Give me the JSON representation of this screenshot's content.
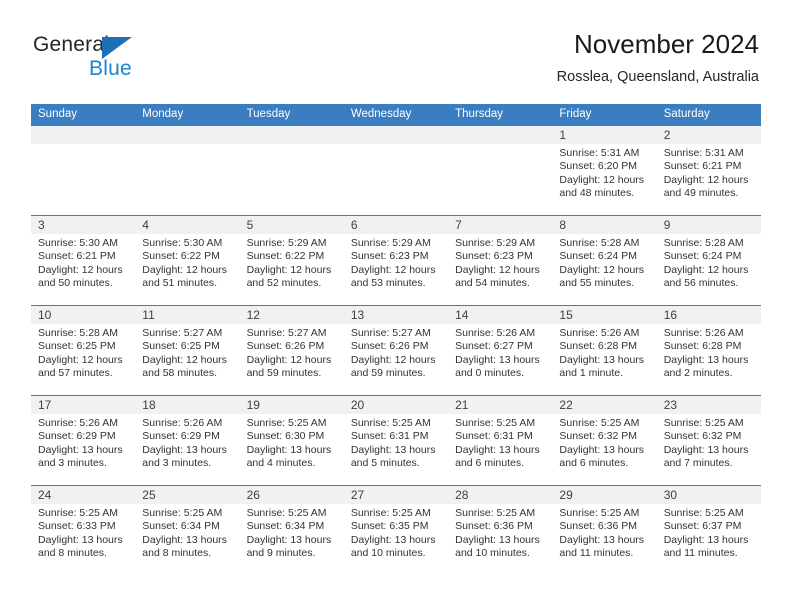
{
  "brand": {
    "name_top": "General",
    "name_bottom": "Blue"
  },
  "header": {
    "title": "November 2024",
    "subtitle": "Rosslea, Queensland, Australia"
  },
  "colors": {
    "header_blue": "#3a7dc0",
    "band_gray": "#f1f1f1",
    "logo_blue": "#1b84cf",
    "text": "#333333"
  },
  "weekdays": [
    "Sunday",
    "Monday",
    "Tuesday",
    "Wednesday",
    "Thursday",
    "Friday",
    "Saturday"
  ],
  "weeks": [
    [
      {
        "day": "",
        "sunrise": "",
        "sunset": "",
        "daylight1": "",
        "daylight2": ""
      },
      {
        "day": "",
        "sunrise": "",
        "sunset": "",
        "daylight1": "",
        "daylight2": ""
      },
      {
        "day": "",
        "sunrise": "",
        "sunset": "",
        "daylight1": "",
        "daylight2": ""
      },
      {
        "day": "",
        "sunrise": "",
        "sunset": "",
        "daylight1": "",
        "daylight2": ""
      },
      {
        "day": "",
        "sunrise": "",
        "sunset": "",
        "daylight1": "",
        "daylight2": ""
      },
      {
        "day": "1",
        "sunrise": "Sunrise: 5:31 AM",
        "sunset": "Sunset: 6:20 PM",
        "daylight1": "Daylight: 12 hours",
        "daylight2": "and 48 minutes."
      },
      {
        "day": "2",
        "sunrise": "Sunrise: 5:31 AM",
        "sunset": "Sunset: 6:21 PM",
        "daylight1": "Daylight: 12 hours",
        "daylight2": "and 49 minutes."
      }
    ],
    [
      {
        "day": "3",
        "sunrise": "Sunrise: 5:30 AM",
        "sunset": "Sunset: 6:21 PM",
        "daylight1": "Daylight: 12 hours",
        "daylight2": "and 50 minutes."
      },
      {
        "day": "4",
        "sunrise": "Sunrise: 5:30 AM",
        "sunset": "Sunset: 6:22 PM",
        "daylight1": "Daylight: 12 hours",
        "daylight2": "and 51 minutes."
      },
      {
        "day": "5",
        "sunrise": "Sunrise: 5:29 AM",
        "sunset": "Sunset: 6:22 PM",
        "daylight1": "Daylight: 12 hours",
        "daylight2": "and 52 minutes."
      },
      {
        "day": "6",
        "sunrise": "Sunrise: 5:29 AM",
        "sunset": "Sunset: 6:23 PM",
        "daylight1": "Daylight: 12 hours",
        "daylight2": "and 53 minutes."
      },
      {
        "day": "7",
        "sunrise": "Sunrise: 5:29 AM",
        "sunset": "Sunset: 6:23 PM",
        "daylight1": "Daylight: 12 hours",
        "daylight2": "and 54 minutes."
      },
      {
        "day": "8",
        "sunrise": "Sunrise: 5:28 AM",
        "sunset": "Sunset: 6:24 PM",
        "daylight1": "Daylight: 12 hours",
        "daylight2": "and 55 minutes."
      },
      {
        "day": "9",
        "sunrise": "Sunrise: 5:28 AM",
        "sunset": "Sunset: 6:24 PM",
        "daylight1": "Daylight: 12 hours",
        "daylight2": "and 56 minutes."
      }
    ],
    [
      {
        "day": "10",
        "sunrise": "Sunrise: 5:28 AM",
        "sunset": "Sunset: 6:25 PM",
        "daylight1": "Daylight: 12 hours",
        "daylight2": "and 57 minutes."
      },
      {
        "day": "11",
        "sunrise": "Sunrise: 5:27 AM",
        "sunset": "Sunset: 6:25 PM",
        "daylight1": "Daylight: 12 hours",
        "daylight2": "and 58 minutes."
      },
      {
        "day": "12",
        "sunrise": "Sunrise: 5:27 AM",
        "sunset": "Sunset: 6:26 PM",
        "daylight1": "Daylight: 12 hours",
        "daylight2": "and 59 minutes."
      },
      {
        "day": "13",
        "sunrise": "Sunrise: 5:27 AM",
        "sunset": "Sunset: 6:26 PM",
        "daylight1": "Daylight: 12 hours",
        "daylight2": "and 59 minutes."
      },
      {
        "day": "14",
        "sunrise": "Sunrise: 5:26 AM",
        "sunset": "Sunset: 6:27 PM",
        "daylight1": "Daylight: 13 hours",
        "daylight2": "and 0 minutes."
      },
      {
        "day": "15",
        "sunrise": "Sunrise: 5:26 AM",
        "sunset": "Sunset: 6:28 PM",
        "daylight1": "Daylight: 13 hours",
        "daylight2": "and 1 minute."
      },
      {
        "day": "16",
        "sunrise": "Sunrise: 5:26 AM",
        "sunset": "Sunset: 6:28 PM",
        "daylight1": "Daylight: 13 hours",
        "daylight2": "and 2 minutes."
      }
    ],
    [
      {
        "day": "17",
        "sunrise": "Sunrise: 5:26 AM",
        "sunset": "Sunset: 6:29 PM",
        "daylight1": "Daylight: 13 hours",
        "daylight2": "and 3 minutes."
      },
      {
        "day": "18",
        "sunrise": "Sunrise: 5:26 AM",
        "sunset": "Sunset: 6:29 PM",
        "daylight1": "Daylight: 13 hours",
        "daylight2": "and 3 minutes."
      },
      {
        "day": "19",
        "sunrise": "Sunrise: 5:25 AM",
        "sunset": "Sunset: 6:30 PM",
        "daylight1": "Daylight: 13 hours",
        "daylight2": "and 4 minutes."
      },
      {
        "day": "20",
        "sunrise": "Sunrise: 5:25 AM",
        "sunset": "Sunset: 6:31 PM",
        "daylight1": "Daylight: 13 hours",
        "daylight2": "and 5 minutes."
      },
      {
        "day": "21",
        "sunrise": "Sunrise: 5:25 AM",
        "sunset": "Sunset: 6:31 PM",
        "daylight1": "Daylight: 13 hours",
        "daylight2": "and 6 minutes."
      },
      {
        "day": "22",
        "sunrise": "Sunrise: 5:25 AM",
        "sunset": "Sunset: 6:32 PM",
        "daylight1": "Daylight: 13 hours",
        "daylight2": "and 6 minutes."
      },
      {
        "day": "23",
        "sunrise": "Sunrise: 5:25 AM",
        "sunset": "Sunset: 6:32 PM",
        "daylight1": "Daylight: 13 hours",
        "daylight2": "and 7 minutes."
      }
    ],
    [
      {
        "day": "24",
        "sunrise": "Sunrise: 5:25 AM",
        "sunset": "Sunset: 6:33 PM",
        "daylight1": "Daylight: 13 hours",
        "daylight2": "and 8 minutes."
      },
      {
        "day": "25",
        "sunrise": "Sunrise: 5:25 AM",
        "sunset": "Sunset: 6:34 PM",
        "daylight1": "Daylight: 13 hours",
        "daylight2": "and 8 minutes."
      },
      {
        "day": "26",
        "sunrise": "Sunrise: 5:25 AM",
        "sunset": "Sunset: 6:34 PM",
        "daylight1": "Daylight: 13 hours",
        "daylight2": "and 9 minutes."
      },
      {
        "day": "27",
        "sunrise": "Sunrise: 5:25 AM",
        "sunset": "Sunset: 6:35 PM",
        "daylight1": "Daylight: 13 hours",
        "daylight2": "and 10 minutes."
      },
      {
        "day": "28",
        "sunrise": "Sunrise: 5:25 AM",
        "sunset": "Sunset: 6:36 PM",
        "daylight1": "Daylight: 13 hours",
        "daylight2": "and 10 minutes."
      },
      {
        "day": "29",
        "sunrise": "Sunrise: 5:25 AM",
        "sunset": "Sunset: 6:36 PM",
        "daylight1": "Daylight: 13 hours",
        "daylight2": "and 11 minutes."
      },
      {
        "day": "30",
        "sunrise": "Sunrise: 5:25 AM",
        "sunset": "Sunset: 6:37 PM",
        "daylight1": "Daylight: 13 hours",
        "daylight2": "and 11 minutes."
      }
    ]
  ]
}
